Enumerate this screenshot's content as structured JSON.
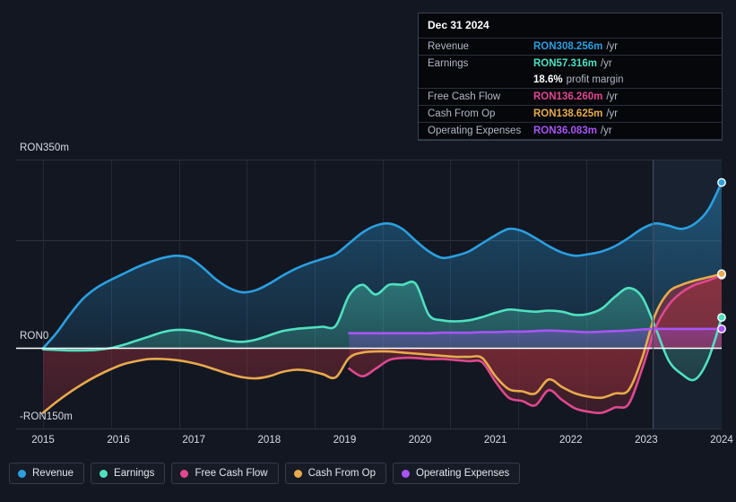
{
  "chart_data": {
    "type": "area",
    "title": "",
    "xlabel": "",
    "ylabel": "",
    "currency": "RON",
    "ylim": [
      -150,
      350
    ],
    "grid": true,
    "legend_position": "bottom",
    "x_tick_labels": [
      "2015",
      "2016",
      "2017",
      "2018",
      "2019",
      "2020",
      "2021",
      "2022",
      "2023",
      "2024"
    ],
    "y_tick_labels": [
      "RON350m",
      "RON0",
      "-RON150m"
    ],
    "y_tick_values": [
      350,
      0,
      -150
    ],
    "forecast_start_x_label": "2024",
    "series": [
      {
        "name": "Revenue",
        "color": "#2b9fe0",
        "end_value": 308.256,
        "values": [
          0,
          28,
          62,
          92,
          112,
          126,
          138,
          150,
          160,
          168,
          172,
          168,
          150,
          128,
          112,
          104,
          108,
          120,
          135,
          148,
          158,
          166,
          175,
          195,
          215,
          228,
          232,
          222,
          200,
          180,
          168,
          172,
          180,
          195,
          210,
          222,
          218,
          205,
          190,
          178,
          172,
          175,
          180,
          190,
          205,
          222,
          232,
          228,
          222,
          232,
          258,
          308.256
        ]
      },
      {
        "name": "Earnings",
        "color": "#4fe0c0",
        "end_value": 57.316,
        "values": [
          -2,
          -3,
          -4,
          -4,
          -3,
          0,
          6,
          14,
          22,
          30,
          34,
          33,
          28,
          20,
          14,
          12,
          16,
          24,
          32,
          36,
          38,
          40,
          42,
          98,
          118,
          100,
          118,
          118,
          120,
          62,
          52,
          50,
          52,
          58,
          66,
          72,
          70,
          68,
          70,
          68,
          62,
          64,
          74,
          96,
          112,
          96,
          40,
          -22,
          -48,
          -58,
          -20,
          57.316
        ]
      },
      {
        "name": "Free Cash Flow",
        "color": "#e0488f",
        "end_value": 136.26,
        "values": [
          null,
          null,
          null,
          null,
          null,
          null,
          null,
          null,
          null,
          null,
          null,
          null,
          null,
          null,
          null,
          null,
          null,
          null,
          null,
          null,
          null,
          null,
          null,
          -38,
          -52,
          -38,
          -22,
          -18,
          -18,
          -20,
          -20,
          -22,
          -24,
          -26,
          -62,
          -92,
          -98,
          -106,
          -78,
          -96,
          -112,
          -118,
          -120,
          -110,
          -104,
          -40,
          36,
          80,
          104,
          118,
          126,
          136.26
        ]
      },
      {
        "name": "Cash From Op",
        "color": "#e8aa4c",
        "end_value": 138.625,
        "values": [
          -120,
          -100,
          -82,
          -66,
          -52,
          -40,
          -30,
          -24,
          -20,
          -20,
          -22,
          -26,
          -32,
          -40,
          -48,
          -54,
          -56,
          -52,
          -44,
          -40,
          -42,
          -48,
          -54,
          -18,
          -8,
          -6,
          -6,
          -8,
          -10,
          -12,
          -14,
          -16,
          -16,
          -18,
          -52,
          -76,
          -80,
          -84,
          -58,
          -72,
          -84,
          -90,
          -92,
          -84,
          -78,
          -20,
          62,
          104,
          118,
          126,
          132,
          138.625
        ]
      },
      {
        "name": "Operating Expenses",
        "color": "#a855f7",
        "end_value": 36.083,
        "values": [
          null,
          null,
          null,
          null,
          null,
          null,
          null,
          null,
          null,
          null,
          null,
          null,
          null,
          null,
          null,
          null,
          null,
          null,
          null,
          null,
          null,
          null,
          null,
          28,
          28,
          28,
          28,
          28,
          28,
          28,
          29,
          29,
          29,
          30,
          30,
          31,
          31,
          32,
          33,
          32,
          31,
          30,
          31,
          32,
          33,
          35,
          36,
          36,
          36,
          36,
          36,
          36.083
        ]
      }
    ]
  },
  "tooltip": {
    "date": "Dec 31 2024",
    "rows": [
      {
        "key": "Revenue",
        "value": "RON308.256m",
        "unit": "/yr",
        "color": "#2b9fe0"
      },
      {
        "key": "Earnings",
        "value": "RON57.316m",
        "unit": "/yr",
        "color": "#4fe0c0"
      },
      {
        "key": "Free Cash Flow",
        "value": "RON136.260m",
        "unit": "/yr",
        "color": "#e0488f"
      },
      {
        "key": "Cash From Op",
        "value": "RON138.625m",
        "unit": "/yr",
        "color": "#e8aa4c"
      },
      {
        "key": "Operating Expenses",
        "value": "RON36.083m",
        "unit": "/yr",
        "color": "#a855f7"
      }
    ],
    "profit_margin": {
      "value": "18.6%",
      "label": "profit margin"
    }
  },
  "legend": {
    "items": [
      {
        "label": "Revenue",
        "color": "#2b9fe0"
      },
      {
        "label": "Earnings",
        "color": "#4fe0c0"
      },
      {
        "label": "Free Cash Flow",
        "color": "#e0488f"
      },
      {
        "label": "Cash From Op",
        "color": "#e8aa4c"
      },
      {
        "label": "Operating Expenses",
        "color": "#a855f7"
      }
    ]
  },
  "colors": {
    "background": "#131722",
    "grid": "#2c3240",
    "zero_line": "#ffffff",
    "forecast_band": "#1a2433"
  }
}
